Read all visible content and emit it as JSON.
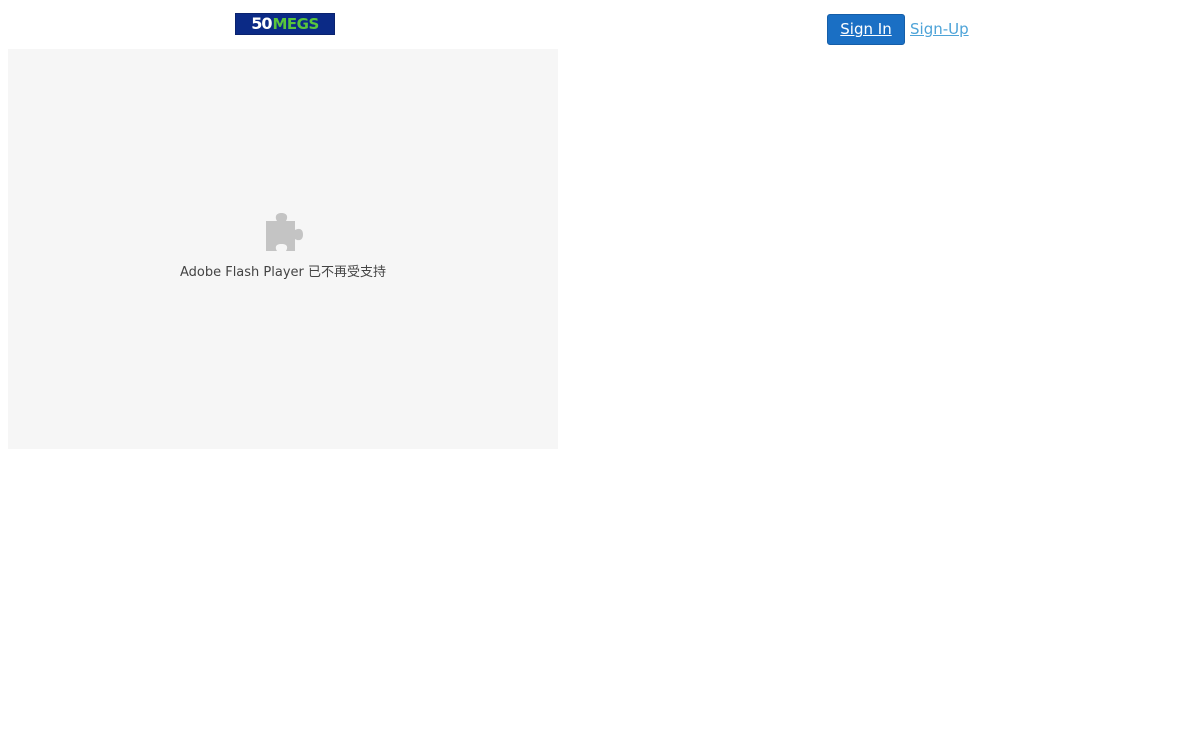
{
  "header": {
    "logo": {
      "digits": "50",
      "text": "MEGS",
      "colors": {
        "background": "#0b2a86",
        "digits": "#ffffff",
        "text": "#59c63c"
      }
    },
    "sign_in_label": "Sign In",
    "sign_up_label": "Sign-Up"
  },
  "plugin": {
    "icon": "puzzle-piece-icon",
    "message": "Adobe Flash Player 已不再受支持"
  },
  "colors": {
    "primary_button": "#1a6fc4",
    "link": "#4da3d8",
    "placeholder_bg": "#f6f6f6",
    "icon_gray": "#c4c4c4"
  }
}
